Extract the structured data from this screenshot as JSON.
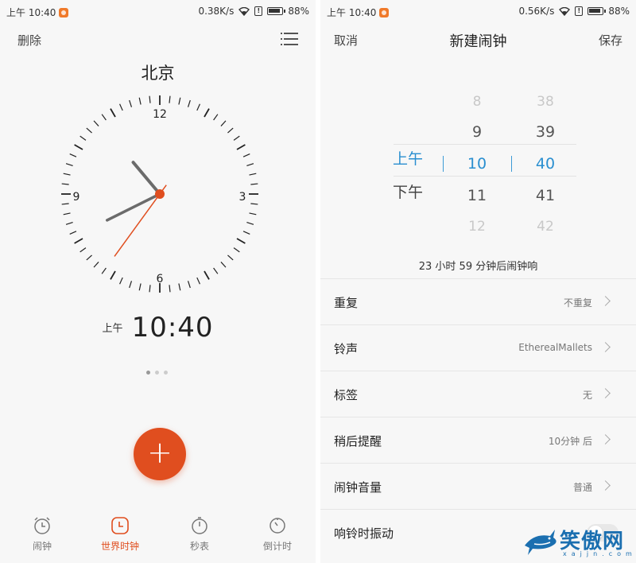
{
  "left_screen": {
    "status_bar": {
      "time": "上午 10:40",
      "speed": "0.38K/s",
      "battery": "88%"
    },
    "header": {
      "delete_label": "删除"
    },
    "city": "北京",
    "clock": {
      "hour": 10,
      "minute": 40,
      "second": 36,
      "labels": [
        "12",
        "3",
        "6",
        "9"
      ],
      "accent_color": "#e04e1f"
    },
    "digital": {
      "ampm": "上午",
      "time": "10:40"
    },
    "page_indicator": {
      "count": 3,
      "active": 0
    },
    "fab": {
      "label": "+"
    },
    "nav": [
      {
        "label": "闹钟",
        "icon": "alarm-icon",
        "active": false
      },
      {
        "label": "世界时钟",
        "icon": "world-clock-icon",
        "active": true
      },
      {
        "label": "秒表",
        "icon": "stopwatch-icon",
        "active": false
      },
      {
        "label": "倒计时",
        "icon": "timer-icon",
        "active": false
      }
    ]
  },
  "right_screen": {
    "status_bar": {
      "time": "上午 10:40",
      "speed": "0.56K/s",
      "battery": "88%"
    },
    "header": {
      "cancel_label": "取消",
      "title": "新建闹钟",
      "save_label": "保存"
    },
    "picker": {
      "ampm": {
        "above": "",
        "selected": "上午",
        "below": "下午"
      },
      "hours": [
        "8",
        "9",
        "10",
        "11",
        "12"
      ],
      "minutes": [
        "38",
        "39",
        "40",
        "41",
        "42"
      ],
      "selected_color": "#2a8fd0"
    },
    "countdown_text": "23 小时 59 分钟后闹钟响",
    "settings": [
      {
        "label": "重复",
        "value": "不重复"
      },
      {
        "label": "铃声",
        "value": "EtherealMallets"
      },
      {
        "label": "标签",
        "value": "无"
      },
      {
        "label": "稍后提醒",
        "value": "10分钟 后"
      },
      {
        "label": "闹钟音量",
        "value": "普通"
      },
      {
        "label": "响铃时振动",
        "value": "",
        "toggle": true
      }
    ],
    "watermark": {
      "text": "笑傲网",
      "sub": "xajjn.com"
    }
  }
}
